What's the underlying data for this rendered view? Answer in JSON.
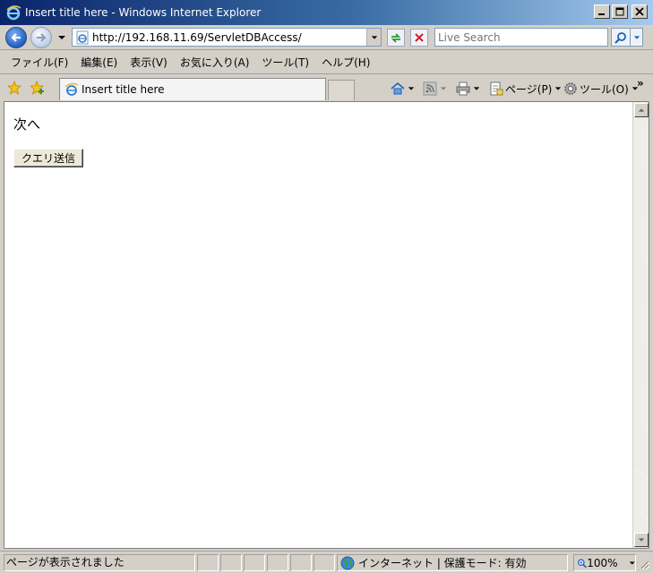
{
  "window": {
    "title": "Insert title here - Windows Internet Explorer"
  },
  "navigation": {
    "url": "http://192.168.11.69/ServletDBAccess/",
    "search_placeholder": "Live Search"
  },
  "menu": {
    "items": [
      {
        "label": "ファイル(F)"
      },
      {
        "label": "編集(E)"
      },
      {
        "label": "表示(V)"
      },
      {
        "label": "お気に入り(A)"
      },
      {
        "label": "ツール(T)"
      },
      {
        "label": "ヘルプ(H)"
      }
    ]
  },
  "tabs": {
    "active_label": "Insert title here"
  },
  "commands": {
    "page_label": "ページ(P)",
    "tools_label": "ツール(O)",
    "more": "»"
  },
  "content": {
    "next_link": "次へ",
    "query_button": "クエリ送信"
  },
  "status": {
    "message": "ページが表示されました",
    "zone": "インターネット | 保護モード: 有効",
    "zoom": "100%"
  },
  "colors": {
    "titlebar_start": "#0a246a",
    "titlebar_end": "#a6caf0",
    "chrome": "#d4d0c8"
  },
  "icons": {
    "back": "back-arrow-icon",
    "forward": "forward-arrow-icon",
    "refresh": "refresh-icon",
    "stop": "stop-icon",
    "search": "magnifier-icon",
    "favorites": "star-icon",
    "home": "home-icon",
    "feeds": "rss-feed-icon",
    "print": "printer-icon",
    "page": "page-icon",
    "tools": "gear-icon",
    "zone": "globe-icon"
  }
}
